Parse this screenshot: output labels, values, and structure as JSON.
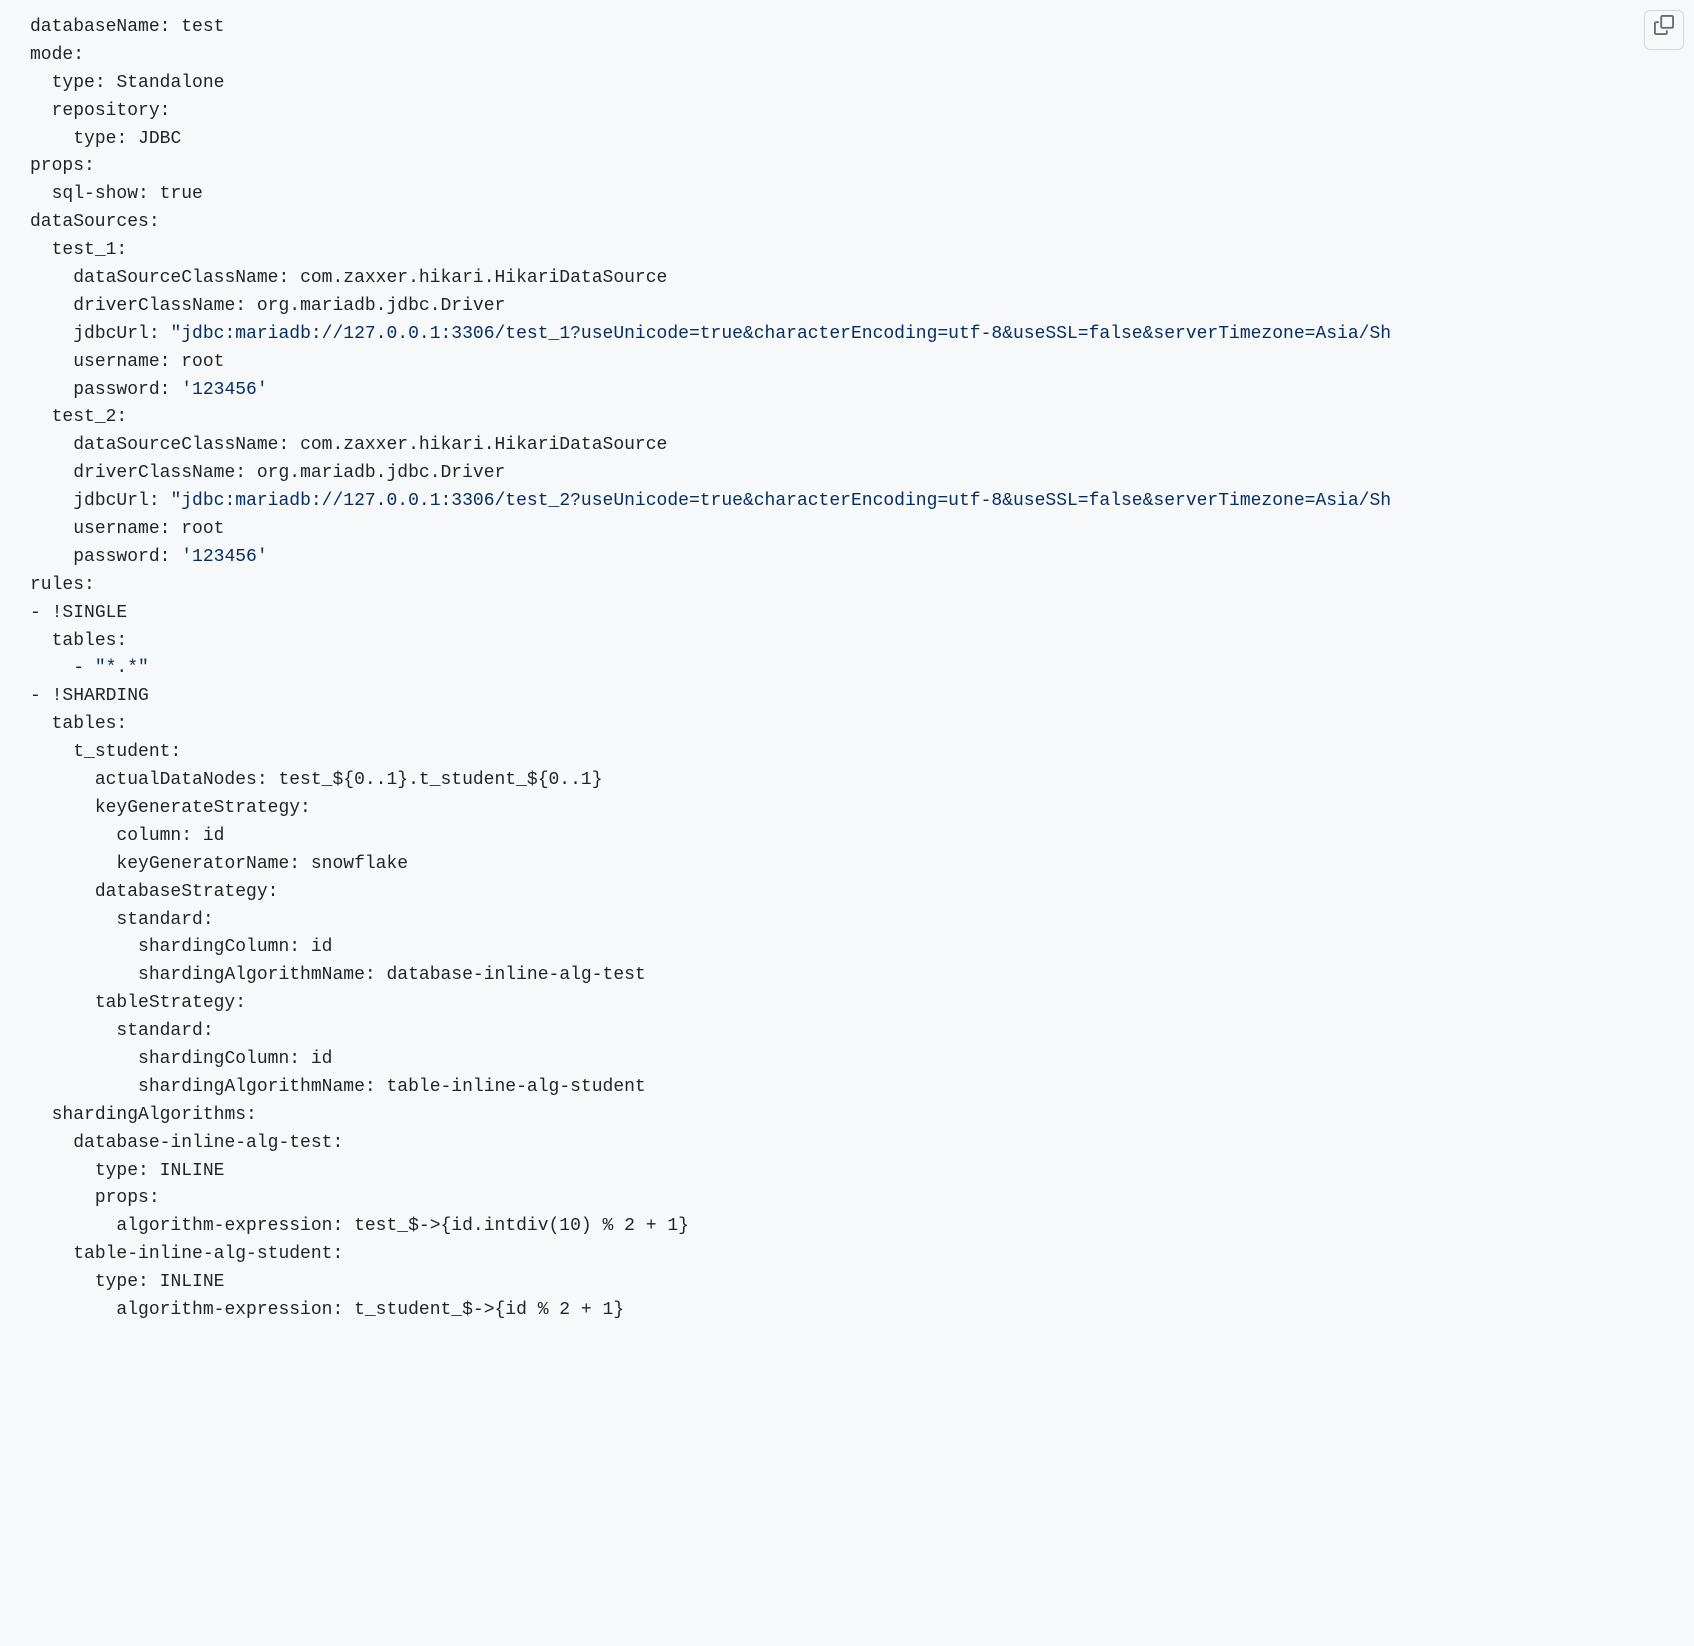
{
  "lines": [
    {
      "indent": 0,
      "segments": [
        {
          "t": "databaseName",
          "c": ""
        },
        {
          "t": ": ",
          "c": ""
        },
        {
          "t": "test",
          "c": ""
        }
      ]
    },
    {
      "indent": 0,
      "segments": [
        {
          "t": "mode",
          "c": ""
        },
        {
          "t": ":",
          "c": ""
        }
      ]
    },
    {
      "indent": 1,
      "segments": [
        {
          "t": "type",
          "c": ""
        },
        {
          "t": ": ",
          "c": ""
        },
        {
          "t": "Standalone",
          "c": ""
        }
      ]
    },
    {
      "indent": 1,
      "segments": [
        {
          "t": "repository",
          "c": ""
        },
        {
          "t": ":",
          "c": ""
        }
      ]
    },
    {
      "indent": 2,
      "segments": [
        {
          "t": "type",
          "c": ""
        },
        {
          "t": ": ",
          "c": ""
        },
        {
          "t": "JDBC",
          "c": ""
        }
      ]
    },
    {
      "indent": 0,
      "segments": [
        {
          "t": "props",
          "c": ""
        },
        {
          "t": ":",
          "c": ""
        }
      ]
    },
    {
      "indent": 1,
      "segments": [
        {
          "t": "sql-show",
          "c": ""
        },
        {
          "t": ": ",
          "c": ""
        },
        {
          "t": "true",
          "c": ""
        }
      ]
    },
    {
      "indent": 0,
      "segments": [
        {
          "t": "dataSources",
          "c": ""
        },
        {
          "t": ":",
          "c": ""
        }
      ]
    },
    {
      "indent": 1,
      "segments": [
        {
          "t": "test_1",
          "c": ""
        },
        {
          "t": ":",
          "c": ""
        }
      ]
    },
    {
      "indent": 2,
      "segments": [
        {
          "t": "dataSourceClassName",
          "c": ""
        },
        {
          "t": ": ",
          "c": ""
        },
        {
          "t": "com.zaxxer.hikari.HikariDataSource",
          "c": ""
        }
      ]
    },
    {
      "indent": 2,
      "segments": [
        {
          "t": "driverClassName",
          "c": ""
        },
        {
          "t": ": ",
          "c": ""
        },
        {
          "t": "org.mariadb.jdbc.Driver",
          "c": ""
        }
      ]
    },
    {
      "indent": 2,
      "segments": [
        {
          "t": "jdbcUrl",
          "c": ""
        },
        {
          "t": ": ",
          "c": ""
        },
        {
          "t": "\"jdbc:mariadb://127.0.0.1:3306/test_1?useUnicode=true&characterEncoding=utf-8&useSSL=false&serverTimezone=Asia/Sh",
          "c": "s"
        }
      ]
    },
    {
      "indent": 2,
      "segments": [
        {
          "t": "username",
          "c": ""
        },
        {
          "t": ": ",
          "c": ""
        },
        {
          "t": "root",
          "c": ""
        }
      ]
    },
    {
      "indent": 2,
      "segments": [
        {
          "t": "password",
          "c": ""
        },
        {
          "t": ": ",
          "c": ""
        },
        {
          "t": "'123456'",
          "c": "s"
        }
      ]
    },
    {
      "indent": 1,
      "segments": [
        {
          "t": "test_2",
          "c": ""
        },
        {
          "t": ":",
          "c": ""
        }
      ]
    },
    {
      "indent": 2,
      "segments": [
        {
          "t": "dataSourceClassName",
          "c": ""
        },
        {
          "t": ": ",
          "c": ""
        },
        {
          "t": "com.zaxxer.hikari.HikariDataSource",
          "c": ""
        }
      ]
    },
    {
      "indent": 2,
      "segments": [
        {
          "t": "driverClassName",
          "c": ""
        },
        {
          "t": ": ",
          "c": ""
        },
        {
          "t": "org.mariadb.jdbc.Driver",
          "c": ""
        }
      ]
    },
    {
      "indent": 2,
      "segments": [
        {
          "t": "jdbcUrl",
          "c": ""
        },
        {
          "t": ": ",
          "c": ""
        },
        {
          "t": "\"jdbc:mariadb://127.0.0.1:3306/test_2?useUnicode=true&characterEncoding=utf-8&useSSL=false&serverTimezone=Asia/Sh",
          "c": "s"
        }
      ]
    },
    {
      "indent": 2,
      "segments": [
        {
          "t": "username",
          "c": ""
        },
        {
          "t": ": ",
          "c": ""
        },
        {
          "t": "root",
          "c": ""
        }
      ]
    },
    {
      "indent": 2,
      "segments": [
        {
          "t": "password",
          "c": ""
        },
        {
          "t": ": ",
          "c": ""
        },
        {
          "t": "'123456'",
          "c": "s"
        }
      ]
    },
    {
      "indent": 0,
      "segments": [
        {
          "t": "rules",
          "c": ""
        },
        {
          "t": ":",
          "c": ""
        }
      ]
    },
    {
      "indent": 0,
      "segments": [
        {
          "t": "- ",
          "c": ""
        },
        {
          "t": "!SINGLE",
          "c": ""
        }
      ]
    },
    {
      "indent": 1,
      "segments": [
        {
          "t": "tables",
          "c": ""
        },
        {
          "t": ":",
          "c": ""
        }
      ]
    },
    {
      "indent": 2,
      "segments": [
        {
          "t": "- ",
          "c": ""
        },
        {
          "t": "\"*.*\"",
          "c": "s"
        }
      ]
    },
    {
      "indent": 0,
      "segments": [
        {
          "t": "- ",
          "c": ""
        },
        {
          "t": "!SHARDING",
          "c": ""
        }
      ]
    },
    {
      "indent": 1,
      "segments": [
        {
          "t": "tables",
          "c": ""
        },
        {
          "t": ":",
          "c": ""
        }
      ]
    },
    {
      "indent": 2,
      "segments": [
        {
          "t": "t_student",
          "c": ""
        },
        {
          "t": ":",
          "c": ""
        }
      ]
    },
    {
      "indent": 3,
      "segments": [
        {
          "t": "actualDataNodes",
          "c": ""
        },
        {
          "t": ": ",
          "c": ""
        },
        {
          "t": "test_${0..1}.t_student_${0..1}",
          "c": ""
        }
      ]
    },
    {
      "indent": 3,
      "segments": [
        {
          "t": "keyGenerateStrategy",
          "c": ""
        },
        {
          "t": ":",
          "c": ""
        }
      ]
    },
    {
      "indent": 4,
      "segments": [
        {
          "t": "column",
          "c": ""
        },
        {
          "t": ": ",
          "c": ""
        },
        {
          "t": "id",
          "c": ""
        }
      ]
    },
    {
      "indent": 4,
      "segments": [
        {
          "t": "keyGeneratorName",
          "c": ""
        },
        {
          "t": ": ",
          "c": ""
        },
        {
          "t": "snowflake",
          "c": ""
        }
      ]
    },
    {
      "indent": 3,
      "segments": [
        {
          "t": "databaseStrategy",
          "c": ""
        },
        {
          "t": ":",
          "c": ""
        }
      ]
    },
    {
      "indent": 4,
      "segments": [
        {
          "t": "standard",
          "c": ""
        },
        {
          "t": ":",
          "c": ""
        }
      ]
    },
    {
      "indent": 5,
      "segments": [
        {
          "t": "shardingColumn",
          "c": ""
        },
        {
          "t": ": ",
          "c": ""
        },
        {
          "t": "id",
          "c": ""
        }
      ]
    },
    {
      "indent": 5,
      "segments": [
        {
          "t": "shardingAlgorithmName",
          "c": ""
        },
        {
          "t": ": ",
          "c": ""
        },
        {
          "t": "database-inline-alg-test",
          "c": ""
        }
      ]
    },
    {
      "indent": 3,
      "segments": [
        {
          "t": "tableStrategy",
          "c": ""
        },
        {
          "t": ":",
          "c": ""
        }
      ]
    },
    {
      "indent": 4,
      "segments": [
        {
          "t": "standard",
          "c": ""
        },
        {
          "t": ":",
          "c": ""
        }
      ]
    },
    {
      "indent": 5,
      "segments": [
        {
          "t": "shardingColumn",
          "c": ""
        },
        {
          "t": ": ",
          "c": ""
        },
        {
          "t": "id",
          "c": ""
        }
      ]
    },
    {
      "indent": 5,
      "segments": [
        {
          "t": "shardingAlgorithmName",
          "c": ""
        },
        {
          "t": ": ",
          "c": ""
        },
        {
          "t": "table-inline-alg-student",
          "c": ""
        }
      ]
    },
    {
      "indent": 1,
      "segments": [
        {
          "t": "shardingAlgorithms",
          "c": ""
        },
        {
          "t": ":",
          "c": ""
        }
      ]
    },
    {
      "indent": 2,
      "segments": [
        {
          "t": "database-inline-alg-test",
          "c": ""
        },
        {
          "t": ":",
          "c": ""
        }
      ]
    },
    {
      "indent": 3,
      "segments": [
        {
          "t": "type",
          "c": ""
        },
        {
          "t": ": ",
          "c": ""
        },
        {
          "t": "INLINE",
          "c": ""
        }
      ]
    },
    {
      "indent": 3,
      "segments": [
        {
          "t": "props",
          "c": ""
        },
        {
          "t": ":",
          "c": ""
        }
      ]
    },
    {
      "indent": 4,
      "segments": [
        {
          "t": "algorithm-expression",
          "c": ""
        },
        {
          "t": ": ",
          "c": ""
        },
        {
          "t": "test_$->{id.intdiv(10) % 2 + 1}",
          "c": ""
        }
      ]
    },
    {
      "indent": 2,
      "segments": [
        {
          "t": "table-inline-alg-student",
          "c": ""
        },
        {
          "t": ":",
          "c": ""
        }
      ]
    },
    {
      "indent": 3,
      "segments": [
        {
          "t": "type",
          "c": ""
        },
        {
          "t": ": ",
          "c": ""
        },
        {
          "t": "INLINE",
          "c": ""
        }
      ]
    },
    {
      "indent": 4,
      "segments": [
        {
          "t": "algorithm-expression",
          "c": ""
        },
        {
          "t": ": ",
          "c": ""
        },
        {
          "t": "t_student_$->{id % 2 + 1}",
          "c": ""
        }
      ]
    }
  ]
}
